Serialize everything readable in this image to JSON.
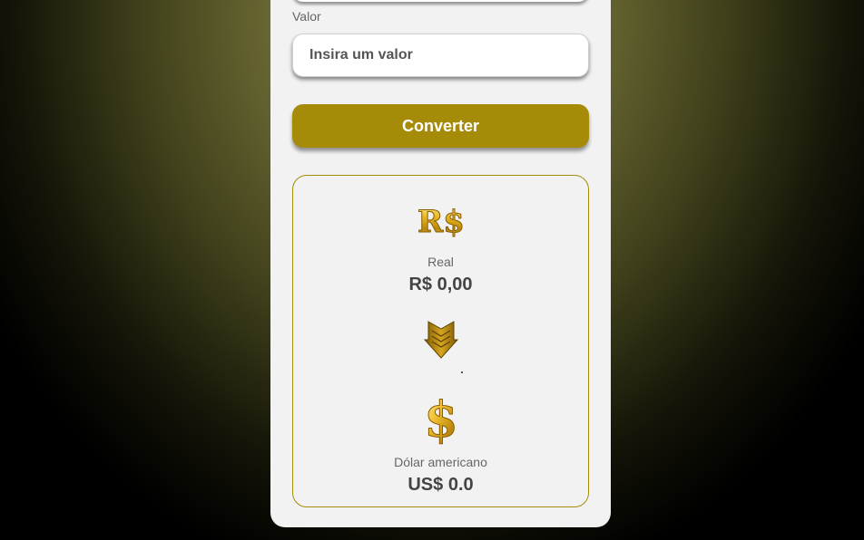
{
  "form": {
    "value_label": "Valor",
    "value_placeholder": "Insira um valor",
    "value_current": "",
    "convert_label": "Converter"
  },
  "result": {
    "from": {
      "icon": "real-currency-icon",
      "name": "Real",
      "amount": "R$ 0,00"
    },
    "arrow_icon": "arrow-down-icon",
    "to": {
      "icon": "dollar-currency-icon",
      "name": "Dólar americano",
      "amount": "US$ 0.0"
    }
  },
  "colors": {
    "accent": "#a58b07",
    "card_bg": "#f2f2f2",
    "page_gradient_center": "#8e8a4e",
    "page_gradient_edge": "#000000"
  }
}
